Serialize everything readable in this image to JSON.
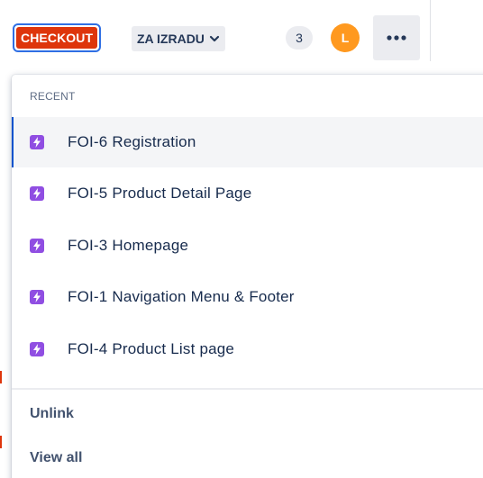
{
  "toolbar": {
    "epic_label": "CHECKOUT",
    "status_label": "ZA IZRADU",
    "count": "3",
    "avatar_initial": "L",
    "more_icon": "more-horizontal-icon"
  },
  "menu": {
    "section_title": "RECENT",
    "items": [
      {
        "label": "FOI-6 Registration",
        "icon": "story-icon",
        "active": true
      },
      {
        "label": "FOI-5 Product Detail Page",
        "icon": "story-icon",
        "active": false
      },
      {
        "label": "FOI-3 Homepage",
        "icon": "story-icon",
        "active": false
      },
      {
        "label": "FOI-1 Navigation Menu & Footer",
        "icon": "story-icon",
        "active": false
      },
      {
        "label": "FOI-4 Product List page",
        "icon": "story-icon",
        "active": false
      }
    ],
    "actions": {
      "unlink": "Unlink",
      "view_all": "View all"
    }
  },
  "colors": {
    "epic": "#de350b",
    "focus_ring": "#2f6fe4",
    "avatar": "#ff991f",
    "story": "#904ee2",
    "active_indicator": "#0052cc"
  }
}
